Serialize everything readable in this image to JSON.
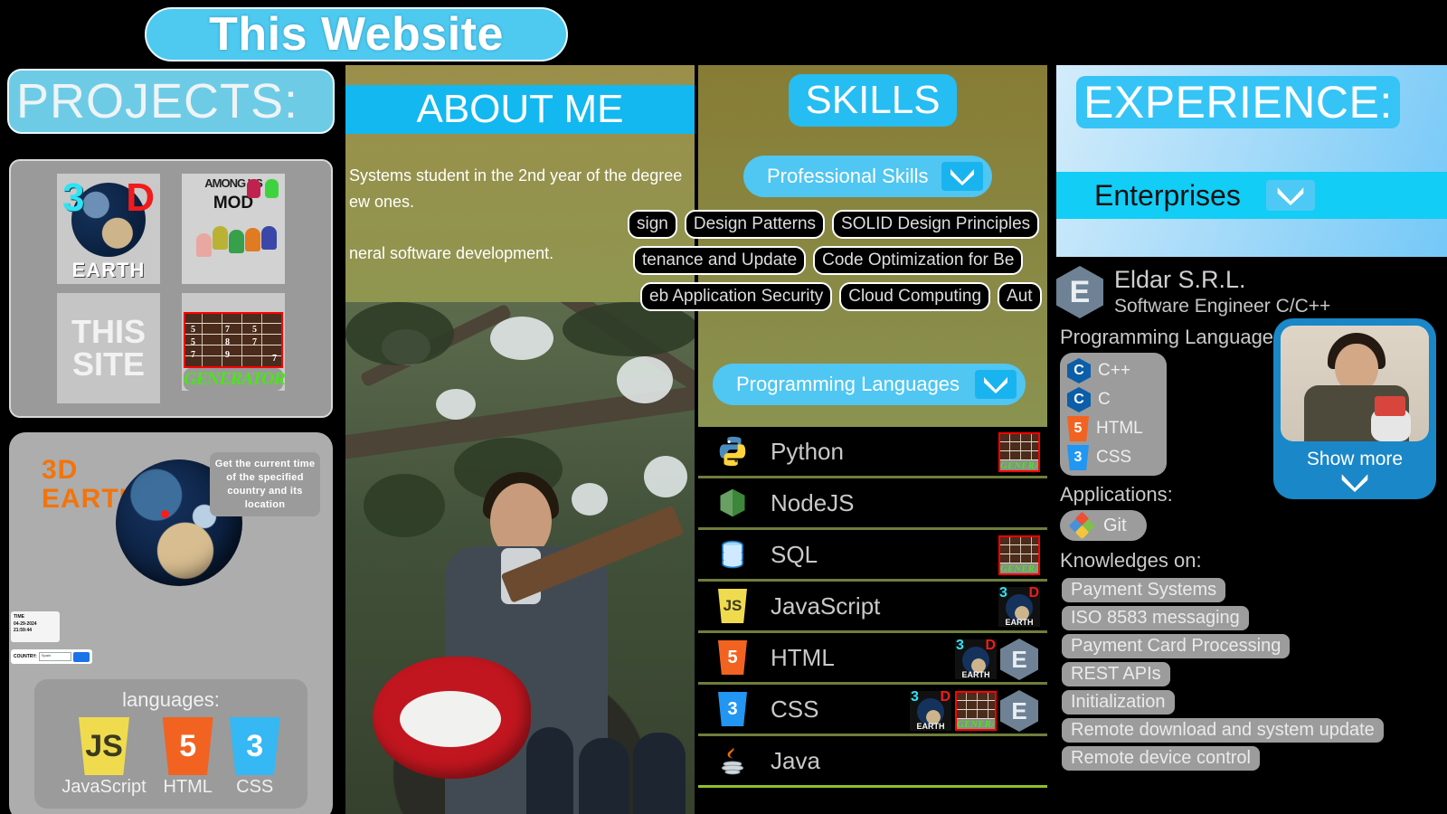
{
  "site": {
    "title": "This Website"
  },
  "projects": {
    "heading": "PROJECTS:",
    "thumbs": [
      {
        "name": "3d-earth",
        "title_a": "3",
        "title_b": "D",
        "caption": "EARTH"
      },
      {
        "name": "among-us-mod",
        "title": "AMONG US",
        "sub": "MOD"
      },
      {
        "name": "this-site",
        "line1": "THIS",
        "line2": "SITE"
      },
      {
        "name": "chord-generator",
        "caption": "GENERATOR"
      }
    ],
    "detail": {
      "title_line1": "3D",
      "title_line2": "EARTH",
      "note": "Get the current time of the specified country and its location",
      "time_widget": {
        "label": "TIME",
        "date": "04-29-2024",
        "clock": "21:59:44"
      },
      "country_widget": {
        "label": "COUNTRY:",
        "value": "Spain"
      },
      "languages_caption": "languages:",
      "languages": [
        {
          "name": "JavaScript",
          "glyph": "JS"
        },
        {
          "name": "HTML",
          "glyph": "5"
        },
        {
          "name": "CSS",
          "glyph": "3"
        }
      ]
    }
  },
  "about": {
    "heading": "ABOUT ME",
    "paragraphs": [
      "Systems student in the 2nd year of the degree",
      "ew ones.",
      "neral software development."
    ]
  },
  "skills": {
    "heading": "SKILLS",
    "professional_button": "Professional Skills",
    "programming_button": "Programming Languages",
    "tag_rows": [
      [
        "sign",
        "Design Patterns",
        "SOLID Design Principles"
      ],
      [
        "tenance and Update",
        "Code Optimization for Be"
      ],
      [
        "eb Application Security",
        "Cloud Computing",
        "Aut"
      ]
    ],
    "languages": [
      {
        "name": "Python",
        "icon": "python-icon",
        "thumbs": [
          "chord-generator"
        ]
      },
      {
        "name": "NodeJS",
        "icon": "nodejs-icon",
        "thumbs": []
      },
      {
        "name": "SQL",
        "icon": "sql-icon",
        "thumbs": [
          "chord-generator"
        ]
      },
      {
        "name": "JavaScript",
        "icon": "javascript-icon",
        "thumbs": [
          "3d-earth"
        ]
      },
      {
        "name": "HTML",
        "icon": "html-icon",
        "thumbs": [
          "3d-earth",
          "eldar"
        ]
      },
      {
        "name": "CSS",
        "icon": "css-icon",
        "thumbs": [
          "3d-earth",
          "chord-generator",
          "eldar"
        ]
      },
      {
        "name": "Java",
        "icon": "java-icon",
        "thumbs": []
      }
    ]
  },
  "experience": {
    "heading": "EXPERIENCE:",
    "enterprises_button": "Enterprises",
    "company": {
      "name": "Eldar S.R.L.",
      "role": "Software Engineer C/C++",
      "logo_glyph": "E"
    },
    "programming_label": "Programming Languages:",
    "programming": [
      {
        "name": "C++",
        "glyph": "C"
      },
      {
        "name": "C",
        "glyph": "C"
      },
      {
        "name": "HTML",
        "glyph": "5"
      },
      {
        "name": "CSS",
        "glyph": "3"
      }
    ],
    "applications_label": "Applications:",
    "applications": [
      {
        "name": "Git"
      }
    ],
    "knowledge_label": "Knowledges on:",
    "knowledge": [
      "Payment Systems",
      "ISO 8583 messaging",
      "Payment Card Processing",
      "REST APIs",
      "Initialization",
      "Remote download and system update",
      "Remote device control"
    ],
    "show_more": "Show more"
  }
}
